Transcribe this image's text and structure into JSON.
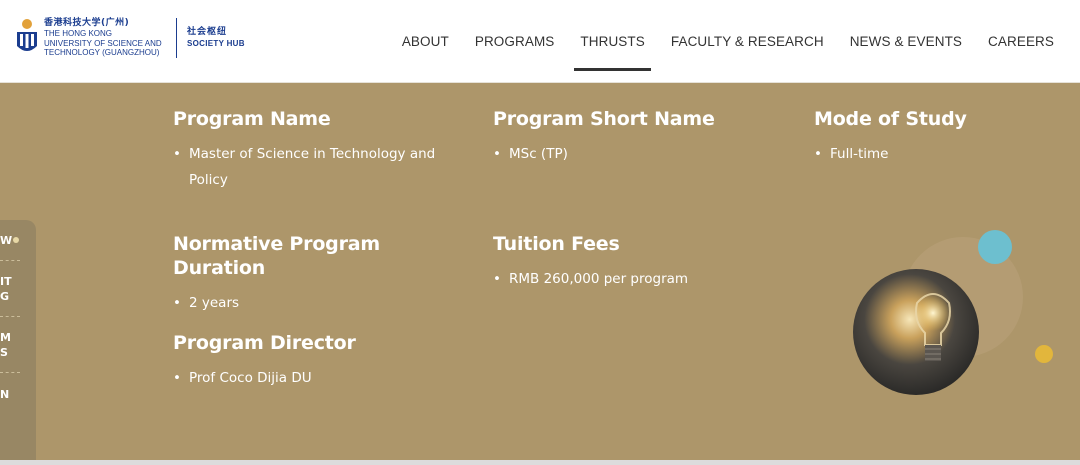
{
  "header": {
    "logo": {
      "cn": "香港科技大学(广州)",
      "en_line1": "THE HONG KONG",
      "en_line2": "UNIVERSITY OF SCIENCE AND",
      "en_line3": "TECHNOLOGY (GUANGZHOU)",
      "hub_cn": "社会枢纽",
      "hub_en": "SOCIETY HUB"
    },
    "nav": [
      {
        "label": "ABOUT"
      },
      {
        "label": "PROGRAMS"
      },
      {
        "label": "THRUSTS",
        "active": true
      },
      {
        "label": "FACULTY & RESEARCH"
      },
      {
        "label": "NEWS & EVENTS"
      },
      {
        "label": "CAREERS"
      }
    ]
  },
  "program": {
    "name": {
      "heading": "Program Name",
      "items": [
        "Master of Science in Technology and Policy"
      ]
    },
    "short_name": {
      "heading": "Program Short Name",
      "items": [
        "MSc (TP)"
      ]
    },
    "mode": {
      "heading": "Mode of Study",
      "items": [
        "Full-time"
      ]
    },
    "duration": {
      "heading": "Normative Program Duration",
      "items": [
        "2 years"
      ]
    },
    "fees": {
      "heading": "Tuition Fees",
      "items": [
        "RMB 260,000 per program"
      ]
    },
    "director": {
      "heading": "Program Director",
      "items": [
        "Prof Coco Dijia DU"
      ]
    }
  },
  "sidetab": {
    "items": [
      "W",
      "IT",
      "G",
      "M",
      "S",
      "N"
    ]
  },
  "colors": {
    "panel": "#ad966a",
    "brand_blue": "#1b3d8f",
    "accent_teal": "#6dbfcf",
    "accent_gold": "#e2b63c"
  },
  "icons": {
    "crest": "hkust-crest-icon",
    "bulb": "lightbulb-photo"
  }
}
